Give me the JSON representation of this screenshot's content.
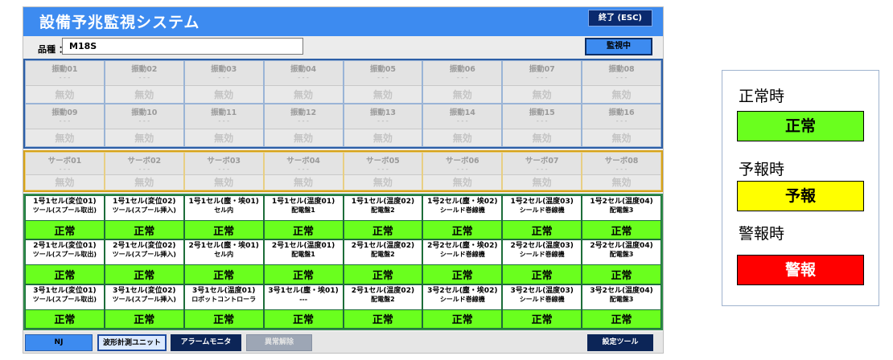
{
  "app": {
    "title": "設備予兆監視システム",
    "exit_label": "終了 (ESC)"
  },
  "product": {
    "label": "品種 ：",
    "value": "M18S"
  },
  "monitor_status": "監視中",
  "vibration": [
    {
      "name": "振動01",
      "sub": "- - -",
      "status": "無効"
    },
    {
      "name": "振動02",
      "sub": "- - -",
      "status": "無効"
    },
    {
      "name": "振動03",
      "sub": "- - -",
      "status": "無効"
    },
    {
      "name": "振動04",
      "sub": "- - -",
      "status": "無効"
    },
    {
      "name": "振動05",
      "sub": "- - -",
      "status": "無効"
    },
    {
      "name": "振動06",
      "sub": "- - -",
      "status": "無効"
    },
    {
      "name": "振動07",
      "sub": "- - -",
      "status": "無効"
    },
    {
      "name": "振動08",
      "sub": "- - -",
      "status": "無効"
    },
    {
      "name": "振動09",
      "sub": "- - -",
      "status": "無効"
    },
    {
      "name": "振動10",
      "sub": "- - -",
      "status": "無効"
    },
    {
      "name": "振動11",
      "sub": "- - -",
      "status": "無効"
    },
    {
      "name": "振動12",
      "sub": "- - -",
      "status": "無効"
    },
    {
      "name": "振動13",
      "sub": "- - -",
      "status": "無効"
    },
    {
      "name": "振動14",
      "sub": "- - -",
      "status": "無効"
    },
    {
      "name": "振動15",
      "sub": "- - -",
      "status": "無効"
    },
    {
      "name": "振動16",
      "sub": "- - -",
      "status": "無効"
    }
  ],
  "servo": [
    {
      "name": "サーボ01",
      "sub": "- - -",
      "status": "無効"
    },
    {
      "name": "サーボ02",
      "sub": "- - -",
      "status": "無効"
    },
    {
      "name": "サーボ03",
      "sub": "- - -",
      "status": "無効"
    },
    {
      "name": "サーボ04",
      "sub": "- - -",
      "status": "無効"
    },
    {
      "name": "サーボ05",
      "sub": "- - -",
      "status": "無効"
    },
    {
      "name": "サーボ06",
      "sub": "- - -",
      "status": "無効"
    },
    {
      "name": "サーボ07",
      "sub": "- - -",
      "status": "無効"
    },
    {
      "name": "サーボ08",
      "sub": "- - -",
      "status": "無効"
    }
  ],
  "sensors": [
    {
      "name": "1号1セル(変位01)",
      "sub": "ツール(スプール取出)",
      "status": "正常"
    },
    {
      "name": "1号1セル(変位02)",
      "sub": "ツール(スプール挿入)",
      "status": "正常"
    },
    {
      "name": "1号1セル(塵・埃01)",
      "sub": "セル内",
      "status": "正常"
    },
    {
      "name": "1号1セル(温度01)",
      "sub": "配電盤1",
      "status": "正常"
    },
    {
      "name": "1号1セル(温度02)",
      "sub": "配電盤2",
      "status": "正常"
    },
    {
      "name": "1号2セル(塵・埃02)",
      "sub": "シールド巻線機",
      "status": "正常"
    },
    {
      "name": "1号2セル(温度03)",
      "sub": "シールド巻線機",
      "status": "正常"
    },
    {
      "name": "1号2セル(温度04)",
      "sub": "配電盤3",
      "status": "正常"
    },
    {
      "name": "2号1セル(変位01)",
      "sub": "ツール(スプール取出)",
      "status": "正常"
    },
    {
      "name": "2号1セル(変位02)",
      "sub": "ツール(スプール挿入)",
      "status": "正常"
    },
    {
      "name": "2号1セル(塵・埃01)",
      "sub": "セル内",
      "status": "正常"
    },
    {
      "name": "2号1セル(温度01)",
      "sub": "配電盤1",
      "status": "正常"
    },
    {
      "name": "2号1セル(温度02)",
      "sub": "配電盤2",
      "status": "正常"
    },
    {
      "name": "2号2セル(塵・埃02)",
      "sub": "シールド巻線機",
      "status": "正常"
    },
    {
      "name": "2号2セル(温度03)",
      "sub": "シールド巻線機",
      "status": "正常"
    },
    {
      "name": "2号2セル(温度04)",
      "sub": "配電盤3",
      "status": "正常"
    },
    {
      "name": "3号1セル(変位01)",
      "sub": "ツール(スプール取出)",
      "status": "正常"
    },
    {
      "name": "3号1セル(変位02)",
      "sub": "ツール(スプール挿入)",
      "status": "正常"
    },
    {
      "name": "3号1セル(温度01)",
      "sub": "ロボットコントローラ",
      "status": "正常"
    },
    {
      "name": "3号1セル(塵・埃01)",
      "sub": "---",
      "status": "正常"
    },
    {
      "name": "2号1セル(温度02)",
      "sub": "配電盤2",
      "status": "正常"
    },
    {
      "name": "3号2セル(塵・埃02)",
      "sub": "シールド巻線機",
      "status": "正常"
    },
    {
      "name": "3号2セル(温度03)",
      "sub": "シールド巻線機",
      "status": "正常"
    },
    {
      "name": "3号2セル(温度04)",
      "sub": "配電盤3",
      "status": "正常"
    }
  ],
  "bottom": {
    "nj_label": "NJ",
    "wave_label": "波形計測ユニット",
    "alarm_monitor_label": "アラームモニタ",
    "reset_label": "異常解除",
    "settings_label": "設定ツール"
  },
  "legend": {
    "normal_label": "正常時",
    "normal_value": "正常",
    "warn_label": "予報時",
    "warn_value": "予報",
    "alarm_label": "警報時",
    "alarm_value": "警報"
  },
  "colors": {
    "normal": "#6aff1e",
    "warning": "#ffff00",
    "alarm": "#ff0000",
    "title_bar": "#3d8bf0",
    "navy": "#0c2557"
  }
}
